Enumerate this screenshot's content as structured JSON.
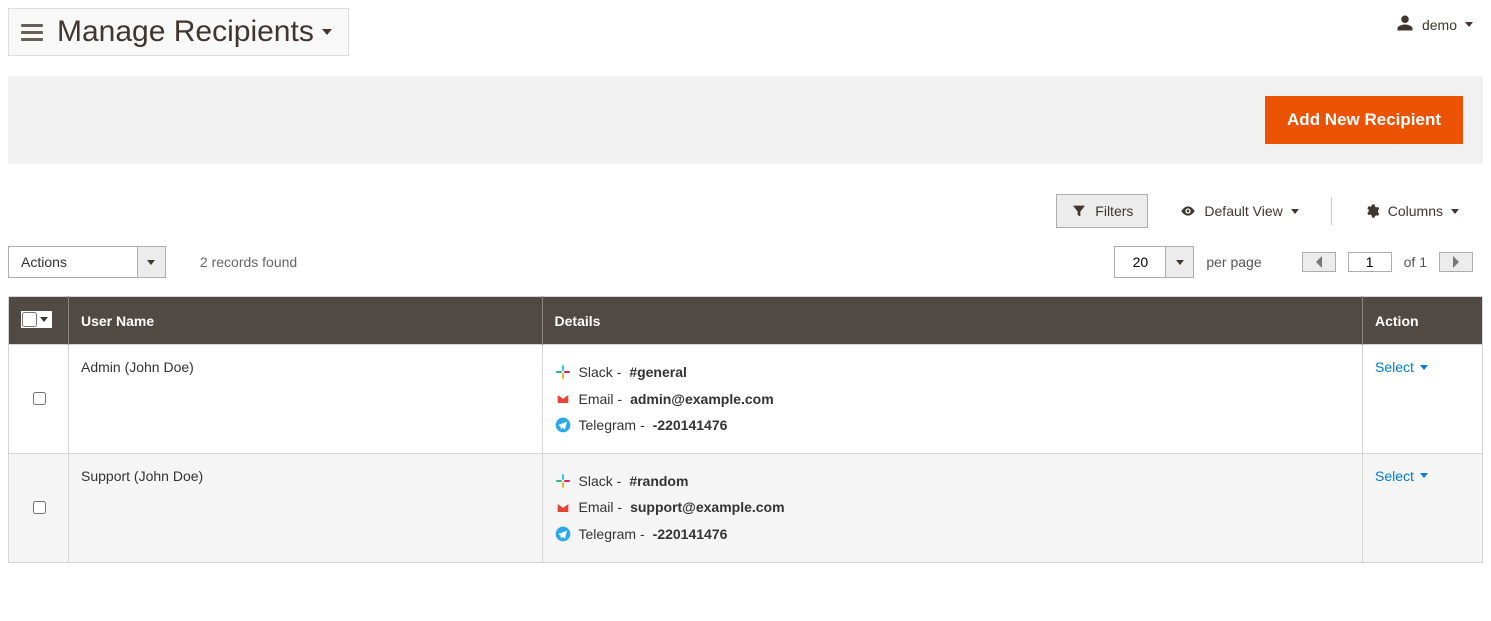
{
  "header": {
    "title": "Manage Recipients",
    "user_label": "demo"
  },
  "primary_action": {
    "label": "Add New Recipient"
  },
  "toolbar": {
    "filters_label": "Filters",
    "view_label": "Default View",
    "columns_label": "Columns"
  },
  "controls": {
    "actions_label": "Actions",
    "records_found": "2 records found",
    "per_page_value": "20",
    "per_page_label": "per page",
    "page_current": "1",
    "page_of_label": "of 1"
  },
  "grid": {
    "columns": {
      "user_name": "User Name",
      "details": "Details",
      "action": "Action"
    },
    "action_select_label": "Select",
    "rows": [
      {
        "user_name": "Admin (John Doe)",
        "details": [
          {
            "service": "Slack",
            "value": "#general",
            "icon": "slack"
          },
          {
            "service": "Email",
            "value": "admin@example.com",
            "icon": "email"
          },
          {
            "service": "Telegram",
            "value": "-220141476",
            "icon": "telegram"
          }
        ]
      },
      {
        "user_name": "Support (John Doe)",
        "details": [
          {
            "service": "Slack",
            "value": "#random",
            "icon": "slack"
          },
          {
            "service": "Email",
            "value": "support@example.com",
            "icon": "email"
          },
          {
            "service": "Telegram",
            "value": "-220141476",
            "icon": "telegram"
          }
        ]
      }
    ]
  }
}
